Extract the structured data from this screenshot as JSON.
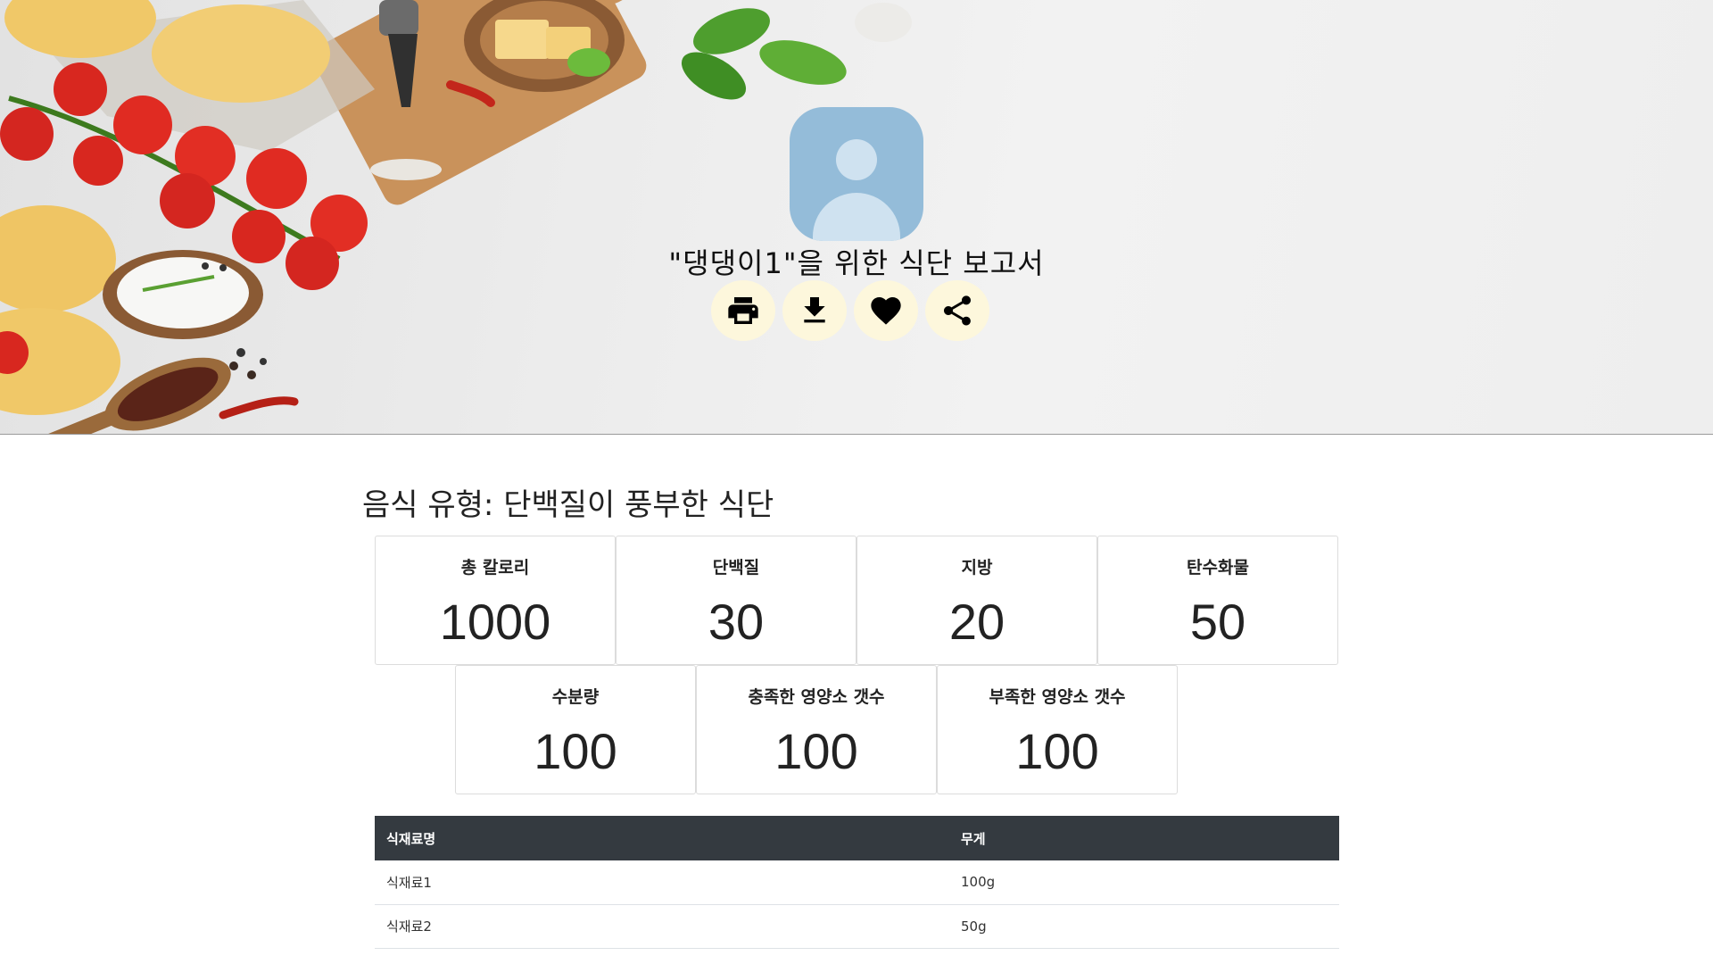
{
  "header": {
    "title": "\"댕댕이1\"을 위한 식단 보고서",
    "actions": [
      {
        "name": "print",
        "icon": "print-icon"
      },
      {
        "name": "download",
        "icon": "download-icon"
      },
      {
        "name": "favorite",
        "icon": "heart-icon"
      },
      {
        "name": "share",
        "icon": "share-icon"
      }
    ],
    "action_bg": "#fdf7dc"
  },
  "report": {
    "food_type": "음식 유형: 단백질이 풍부한 식단",
    "stats": [
      {
        "label": "총 칼로리",
        "value": "1000"
      },
      {
        "label": "단백질",
        "value": "30"
      },
      {
        "label": "지방",
        "value": "20"
      },
      {
        "label": "탄수화물",
        "value": "50"
      },
      {
        "label": "수분량",
        "value": "100"
      },
      {
        "label": "충족한 영양소 갯수",
        "value": "100"
      },
      {
        "label": "부족한 영양소 갯수",
        "value": "100"
      }
    ]
  },
  "ingredients": {
    "headers": [
      "식재료명",
      "무게"
    ],
    "rows": [
      [
        "식재료1",
        "100g"
      ],
      [
        "식재료2",
        "50g"
      ]
    ],
    "header_bg": "#343a40"
  }
}
